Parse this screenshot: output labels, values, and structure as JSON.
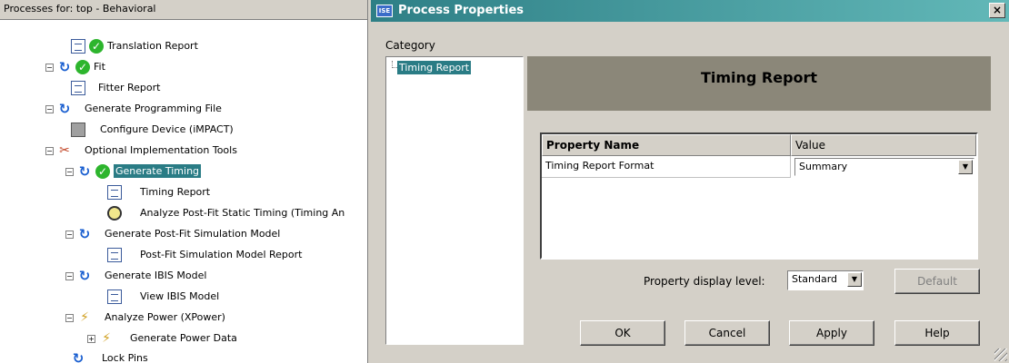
{
  "left_panel": {
    "header": "Processes for: top - Behavioral",
    "items": [
      {
        "label": "Translation Report"
      },
      {
        "label": "Fit"
      },
      {
        "label": "Fitter Report"
      },
      {
        "label": "Generate Programming File"
      },
      {
        "label": "Configure Device (iMPACT)"
      },
      {
        "label": "Optional Implementation Tools"
      },
      {
        "label": "Generate Timing"
      },
      {
        "label": "Timing Report"
      },
      {
        "label": "Analyze Post-Fit Static Timing (Timing An"
      },
      {
        "label": "Generate Post-Fit Simulation Model"
      },
      {
        "label": "Post-Fit Simulation Model Report"
      },
      {
        "label": "Generate IBIS Model"
      },
      {
        "label": "View IBIS Model"
      },
      {
        "label": "Analyze Power (XPower)"
      },
      {
        "label": "Generate Power Data"
      },
      {
        "label": "Lock Pins"
      }
    ]
  },
  "dialog": {
    "title": "Process Properties",
    "title_icon_text": "ISE",
    "close_glyph": "×",
    "category_label": "Category",
    "category_item": "Timing Report",
    "panel_header": "Timing Report",
    "table": {
      "headers": [
        "Property Name",
        "Value"
      ],
      "rows": [
        {
          "name": "Timing Report Format",
          "value": "Summary"
        }
      ]
    },
    "display_level_label": "Property display level:",
    "display_level_value": "Standard",
    "buttons": {
      "default": "Default",
      "ok": "OK",
      "cancel": "Cancel",
      "apply": "Apply",
      "help": "Help"
    }
  },
  "colors": {
    "selection": "#2a7c85",
    "titlebar": "#2e7f86"
  }
}
